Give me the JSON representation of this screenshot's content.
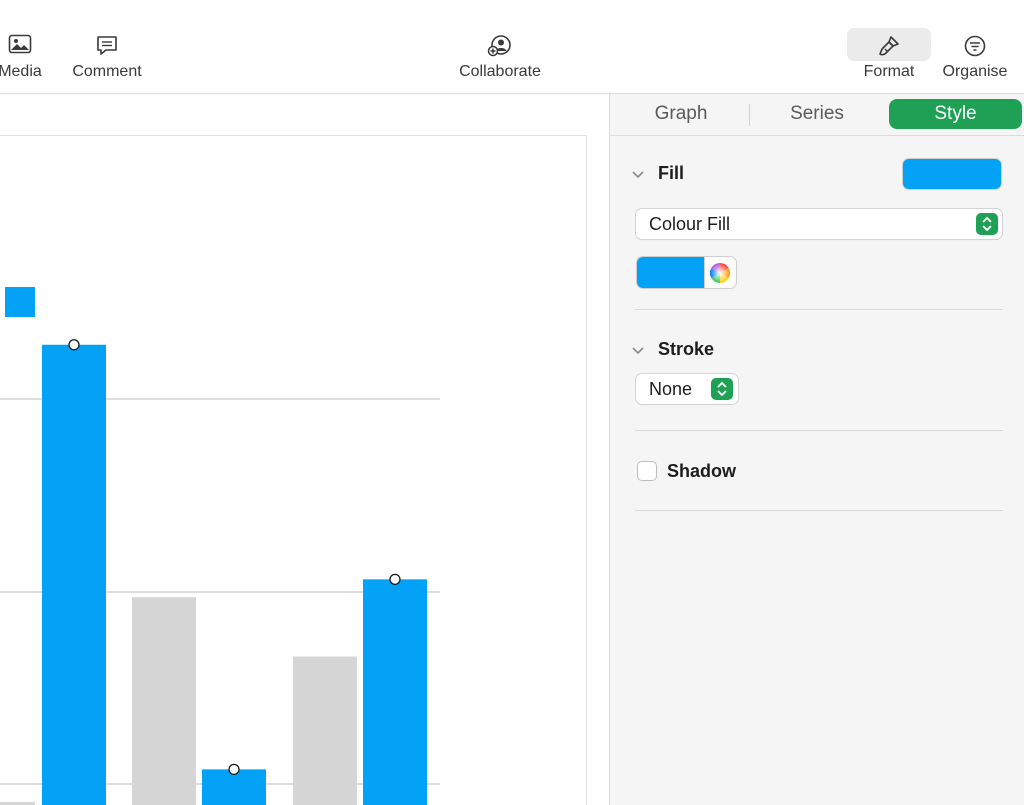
{
  "toolbar": {
    "items": [
      {
        "label": "Media",
        "icon": "media-icon"
      },
      {
        "label": "Comment",
        "icon": "comment-icon"
      },
      {
        "label": "Collaborate",
        "icon": "collaborate-icon"
      },
      {
        "label": "Format",
        "icon": "format-paintbrush-icon"
      },
      {
        "label": "Organise",
        "icon": "organise-icon"
      }
    ]
  },
  "inspector": {
    "tabs": [
      {
        "label": "Graph",
        "active": false
      },
      {
        "label": "Series",
        "active": false
      },
      {
        "label": "Style",
        "active": true
      }
    ],
    "fill": {
      "title": "Fill",
      "color": "#03a2f6",
      "fill_type": "Colour Fill"
    },
    "stroke": {
      "title": "Stroke",
      "value": "None"
    },
    "shadow": {
      "label": "Shadow",
      "checked": false
    }
  },
  "colors": {
    "accent_green": "#1fa155",
    "series_blue": "#03a2f6",
    "series_grey": "#d6d6d6"
  },
  "chart_data": {
    "type": "bar",
    "note_visible": "partial chart, cropped on the left",
    "series": [
      {
        "color": "#d6d6d6",
        "values": [
          0,
          70,
          50
        ]
      },
      {
        "color": "#03a2f6",
        "values": [
          155,
          12,
          76
        ]
      }
    ]
  }
}
